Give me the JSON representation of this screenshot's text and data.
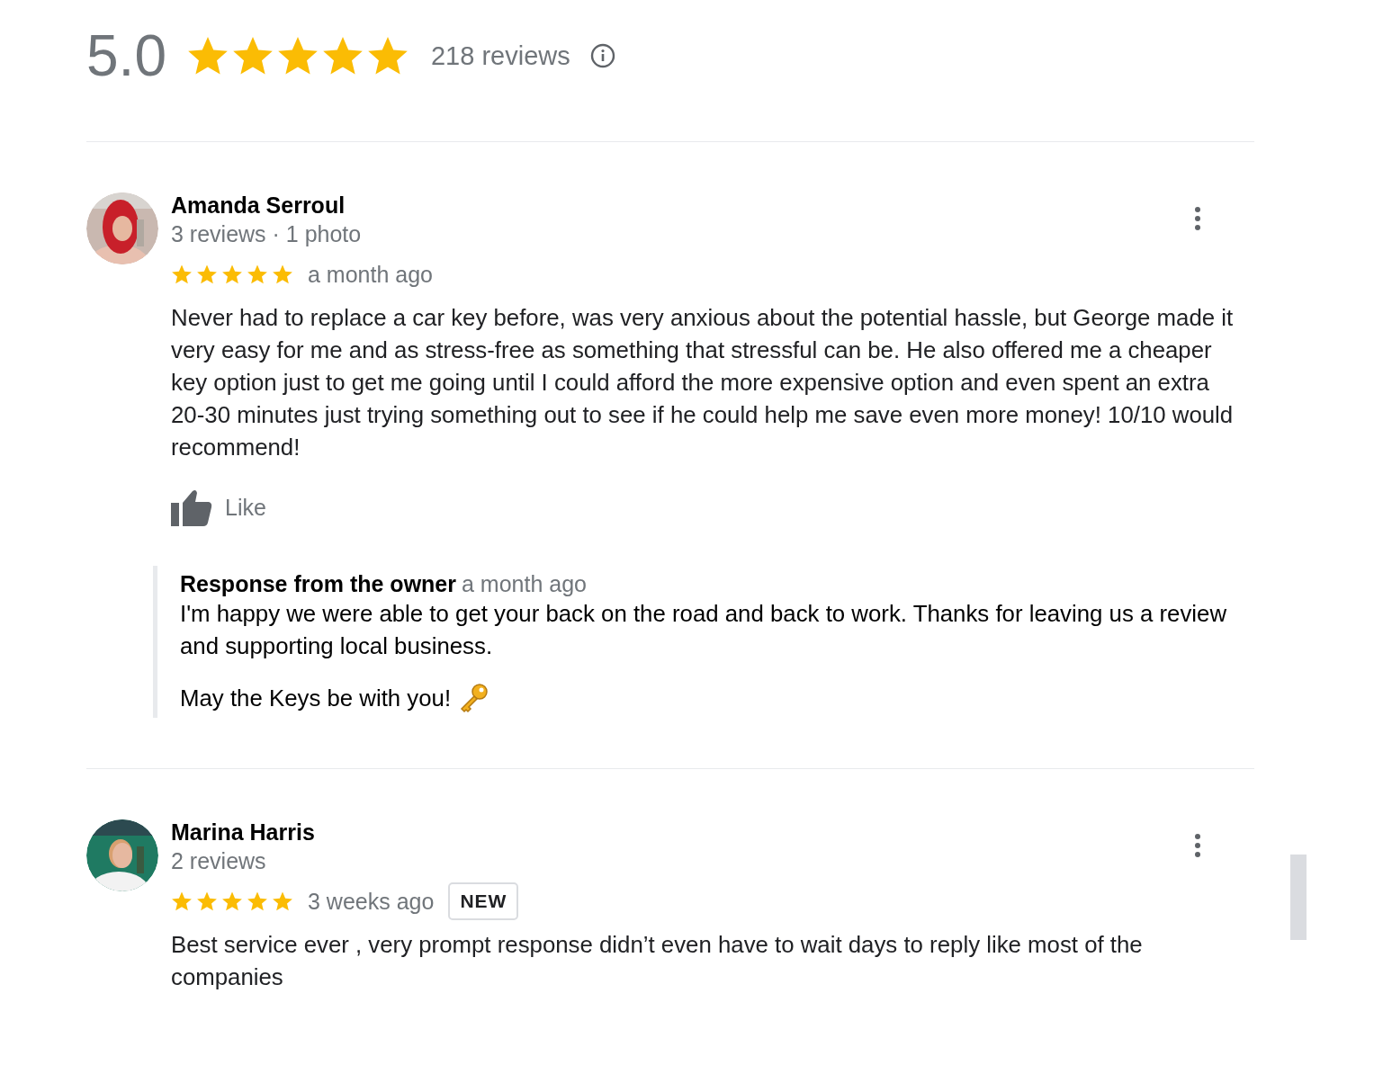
{
  "summary": {
    "rating": "5.0",
    "stars": 5,
    "count": "218 reviews"
  },
  "reviews": [
    {
      "name": "Amanda Serroul",
      "meta": "3 reviews · 1 photo",
      "stars": 5,
      "time": "a month ago",
      "is_new": false,
      "text": "Never had to replace a car key before, was very anxious about the potential hassle, but George made it very easy for me and as stress-free as something that stressful can be. He also offered me a cheaper key option just to get me going until I could afford the more expensive option and even spent an extra 20-30 minutes just trying something out to see if he could help me save even more money! 10/10 would recommend!",
      "like": "Like",
      "response": {
        "title": "Response from the owner",
        "time": "a month ago",
        "paragraphs": [
          "I'm happy we were able to get your back on the road and back to work. Thanks for leaving us a review and supporting local business.",
          "May the Keys be with you!"
        ]
      }
    },
    {
      "name": "Marina Harris",
      "meta": "2 reviews",
      "stars": 5,
      "time": "3 weeks ago",
      "is_new": true,
      "badge": "NEW",
      "text": "Best service ever , very prompt response didn’t even have to wait days to reply like most of the companies"
    }
  ]
}
